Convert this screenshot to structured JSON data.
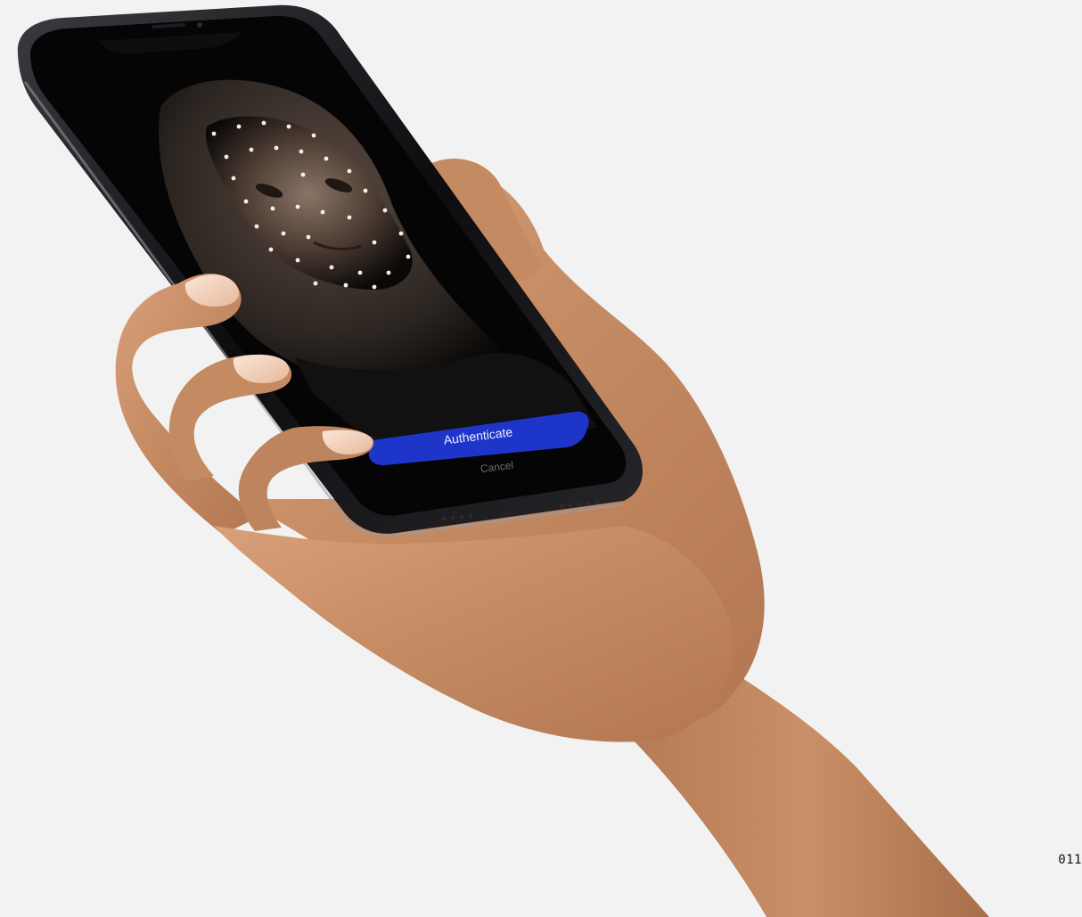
{
  "colors": {
    "background": "#f2f2f2",
    "phone_body": "#0c0c0e",
    "screen": "#050505",
    "accent_button": "#1e35c9",
    "button_text": "#e9edff",
    "cancel_text": "#6b6b73",
    "skin": "#c38b66",
    "dot": "#f4efe9"
  },
  "screen": {
    "primary_button_label": "Authenticate",
    "secondary_label": "Cancel"
  },
  "corner_label": "011",
  "icons": {
    "face_scan_dots": "face-mesh-dots"
  }
}
